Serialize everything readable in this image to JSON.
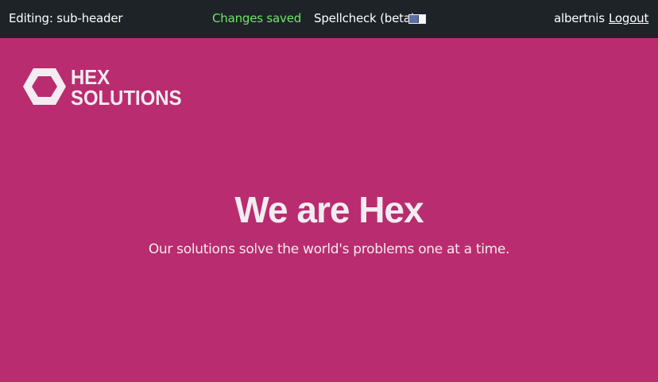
{
  "topbar": {
    "editing_label": "Editing: sub-header",
    "status": "Changes saved",
    "status_color": "#6EE56A",
    "spellcheck_label": "Spellcheck (beta)",
    "spellcheck_enabled": true,
    "username": "albertnis",
    "logout_label": "Logout"
  },
  "logo": {
    "line1": "HEX",
    "line2": "SOLUTIONS",
    "icon": "hexagon-icon"
  },
  "hero": {
    "title": "We are Hex",
    "subtitle": "Our solutions solve the world's problems one at a time."
  },
  "colors": {
    "page_background": "#B92C6F",
    "topbar_background": "#1E2327",
    "text_light": "#F3ECF1"
  }
}
